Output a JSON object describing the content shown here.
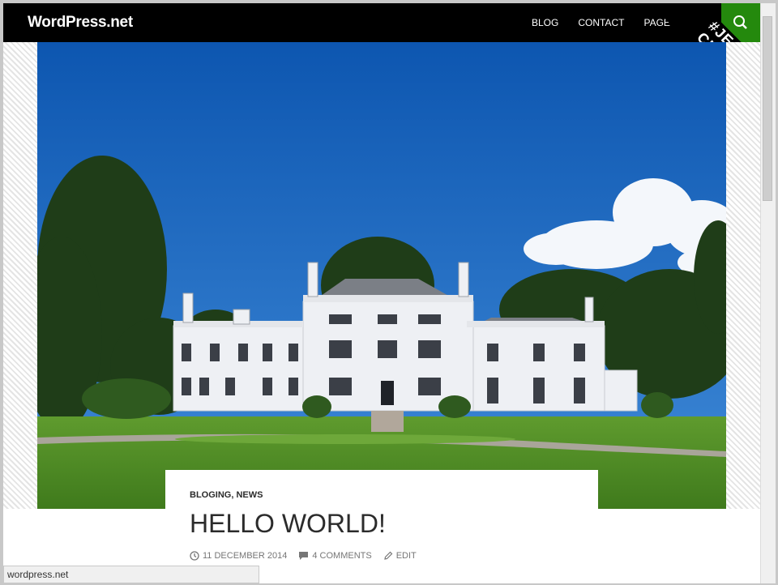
{
  "site": {
    "title": "WordPress.net"
  },
  "nav": {
    "items": [
      "Blog",
      "Contact",
      "Page d'e"
    ]
  },
  "ribbon": {
    "line1": "#JE SUIS",
    "line2": "CHARLIE"
  },
  "post": {
    "categories": [
      "Bloging",
      "News"
    ],
    "title": "HELLO WORLD!",
    "date": "11 December 2014",
    "comments": "4 Comments",
    "edit": "Edit"
  },
  "status_bar": {
    "url": "wordpress.net"
  },
  "colors": {
    "topbar": "#000000",
    "accent": "#24890d",
    "sky": "#1a5fb4",
    "grass": "#4e8a25"
  },
  "icons": {
    "search": "search-icon",
    "clock": "clock-icon",
    "comment": "comment-icon",
    "pencil": "pencil-icon"
  }
}
